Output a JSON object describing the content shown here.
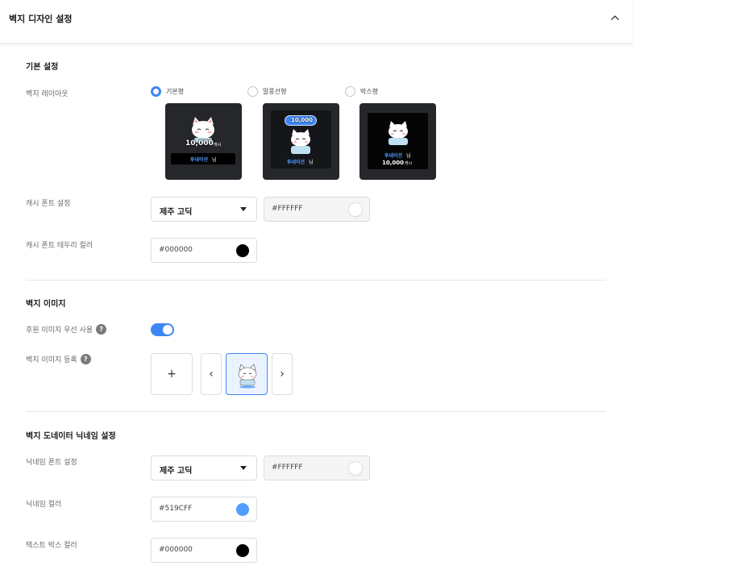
{
  "header": {
    "title": "벽지 디자인 설정",
    "collapse_icon": "chevron-up-icon"
  },
  "basic": {
    "title": "기본 설정",
    "layout_label": "벽지 레이아웃",
    "layouts": [
      {
        "label": "기본형",
        "selected": true
      },
      {
        "label": "말풍선형",
        "selected": false
      },
      {
        "label": "박스형",
        "selected": false
      }
    ],
    "previews": {
      "basic": {
        "amount": "10,000",
        "unit": "캐시",
        "nickname": "투네이션",
        "suffix": "님"
      },
      "bubble": {
        "amount": "10,000",
        "nickname": "투네이션",
        "suffix": "님"
      },
      "box": {
        "nickname": "투네이션",
        "suffix": "님",
        "amount": "10,000",
        "unit": "캐시"
      }
    },
    "cash_font_label": "캐시 폰트 설정",
    "cash_font_value": "제주 고딕",
    "cash_font_color": "#FFFFFF",
    "cash_border_label": "캐시 폰트 테두리 컬러",
    "cash_border_color": "#000000"
  },
  "image": {
    "title": "벽지 이미지",
    "priority_label": "후원 이미지 우선 사용",
    "priority_enabled": true,
    "register_label": "벽지 이미지 등록",
    "add_symbol": "+",
    "prev_symbol": "‹",
    "next_symbol": "›",
    "help_symbol": "?"
  },
  "nickname": {
    "title": "벽지 도네이터 닉네임 설정",
    "font_label": "닉네임 폰트 설정",
    "font_value": "제주 고딕",
    "font_color": "#FFFFFF",
    "color_label": "닉네임 컬러",
    "color_value": "#519CFF",
    "textbox_label": "텍스트 박스 컬러",
    "textbox_color": "#000000"
  },
  "colors": {
    "accent": "#3d87f5",
    "nickname_blue": "#519CFF",
    "preview_bg": "#26272b"
  }
}
